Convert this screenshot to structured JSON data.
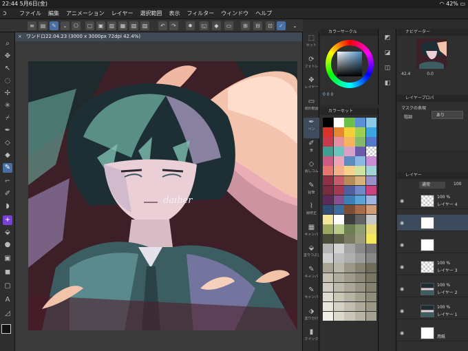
{
  "status_bar": {
    "time": "22:44",
    "date": "5月6日(金)",
    "battery": "42%"
  },
  "menu": {
    "items": [
      "ファイル",
      "編集",
      "アニメーション",
      "レイヤー",
      "選択範囲",
      "表示",
      "フィルター",
      "ウィンドウ",
      "ヘルプ"
    ]
  },
  "document": {
    "tab_title": "ワンドロ22.04.23 (3000 x 3000px 72dpi 42.4%)",
    "signature": "daiber"
  },
  "subtools": [
    "セット",
    "フォトレ",
    "レイヤー",
    "選択範囲",
    "ペン",
    "筆",
    "消しゴム",
    "鉛筆",
    "線修正",
    "キャンバ",
    "塗りつぶし",
    "キャンバ",
    "キャンバ",
    "塗り分け",
    "クイック"
  ],
  "color_circle": {
    "title": "カラーサークル",
    "h": "0",
    "s": "0",
    "v": "0"
  },
  "color_set": {
    "title": "カラーセット",
    "swatches": [
      "#000000",
      "#ffffff",
      "#6bbf4a",
      "#5a8fd6",
      "#8ec9e8",
      "#d8322a",
      "#e6862e",
      "#f2cf38",
      "#9ecf4e",
      "#3da5e0",
      "#c73a4e",
      "#e78fa1",
      "#f4b35c",
      "#85b86b",
      "#5577c9",
      "#3e9e8f",
      "#6bc4c0",
      "#d9a1c7",
      "#6b5aa8",
      "#checker",
      "#cd5a85",
      "#f0a3b7",
      "#5e8bbd",
      "#8ab8e0",
      "#c88ed1",
      "#e77470",
      "#f5b08b",
      "#f8d08a",
      "#cfe3a1",
      "#a2d1d8",
      "#8f3045",
      "#c75a6c",
      "#b78a5c",
      "#d7b27c",
      "#9a8fc8",
      "#7a2b3d",
      "#a43a52",
      "#4f5fa0",
      "#6f8ac6",
      "#c9447d",
      "#5c2a5d",
      "#884f8e",
      "#3b7fb5",
      "#5aa3d6",
      "#9eb3de",
      "#2e4d77",
      "#3f6b9e",
      "#7b4f36",
      "#a96c4a",
      "#cf9d78",
      "#f3e69a",
      "#fefefe",
      "#3d3d3d",
      "#636363",
      "#c9c9c9",
      "#9ba860",
      "#b8c98a",
      "#6b7f53",
      "#8f9e70",
      "#e8d97a",
      "#494c38",
      "#5d5f47",
      "#7a7a60",
      "#9a9a80",
      "#f6e85c",
      "#b5b5b5",
      "#d3d3d3",
      "#a5a5a5",
      "#8a8a8a",
      "#747474",
      "#cfcfcf",
      "#bdbdbd",
      "#aeaeae",
      "#9c9c9c",
      "#888888",
      "#a7a494",
      "#b9b6a7",
      "#9a9788",
      "#85826f",
      "#6f6c5b",
      "#c3c0b2",
      "#b0ad9f",
      "#9e9b8c",
      "#8b8878",
      "#787565",
      "#d0cdc0",
      "#bcb9ab",
      "#aaa798",
      "#979483",
      "#848170",
      "#dedbd0",
      "#c9c6b8",
      "#b6b3a4",
      "#a3a090",
      "#908d7c",
      "#e9e6dc",
      "#d4d1c4",
      "#c1beaf",
      "#aeab9b",
      "#9b9887",
      "#f2efe7",
      "#dddacd",
      "#cac7b9",
      "#b7b4a5",
      "#a4a191"
    ]
  },
  "navigator": {
    "title": "ナビゲーター",
    "zoom": "42.4",
    "rotation": "0.0"
  },
  "layer_property": {
    "title": "レイヤープロパ",
    "mask_label": "マスクの表現",
    "display_label": "階調",
    "display_value": "あり"
  },
  "layer_panel": {
    "title": "レイヤー",
    "blend_mode": "通常",
    "opacity": "100",
    "layers": [
      {
        "pct": "100 %",
        "name": "レイヤー 4",
        "thumb": "checker",
        "selected": false
      },
      {
        "pct": "",
        "name": "",
        "thumb": "white",
        "selected": true
      },
      {
        "pct": "",
        "name": "",
        "thumb": "white",
        "selected": false
      },
      {
        "pct": "100 %",
        "name": "レイヤー 3",
        "thumb": "checker",
        "selected": false
      },
      {
        "pct": "100 %",
        "name": "レイヤー 2",
        "thumb": "art",
        "selected": false
      },
      {
        "pct": "100 %",
        "name": "レイヤー 1",
        "thumb": "art",
        "selected": false
      },
      {
        "pct": "",
        "name": "用紙",
        "thumb": "white",
        "selected": false
      }
    ]
  },
  "colors": {
    "accent": "#4a6fa5",
    "main_color": "#111111",
    "sub_color": "#ffffff"
  }
}
